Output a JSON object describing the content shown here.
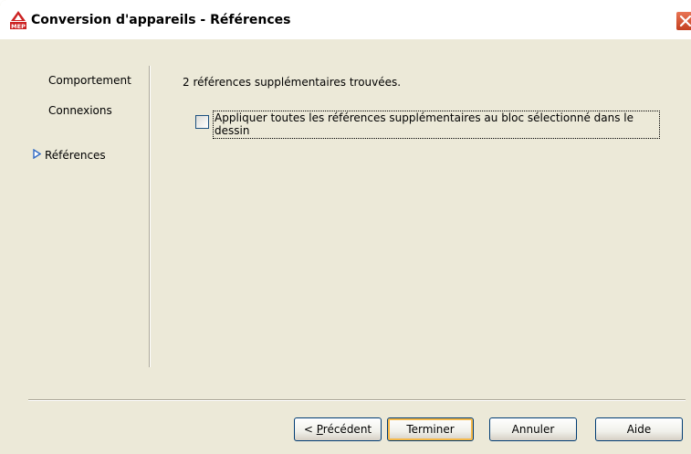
{
  "window": {
    "title": "Conversion d'appareils - Références",
    "app_icon_text": "MEP"
  },
  "sidebar": {
    "items": [
      {
        "label": "Comportement",
        "active": false
      },
      {
        "label": "Connexions",
        "active": false
      },
      {
        "label": "Références",
        "active": true
      }
    ]
  },
  "main": {
    "found_text": "2 références supplémentaires trouvées.",
    "checkbox": {
      "checked": false,
      "label": "Appliquer toutes les références supplémentaires au bloc sélectionné dans le dessin"
    }
  },
  "footer": {
    "prev_label_prefix": "< ",
    "prev_label_mnemonic": "P",
    "prev_label_rest": "récédent",
    "finish_label": "Terminer",
    "cancel_label": "Annuler",
    "help_label": "Aide"
  },
  "colors": {
    "window_bg": "#ece9d8",
    "arrow": "#316ac5",
    "close_red": "#d4502e"
  }
}
